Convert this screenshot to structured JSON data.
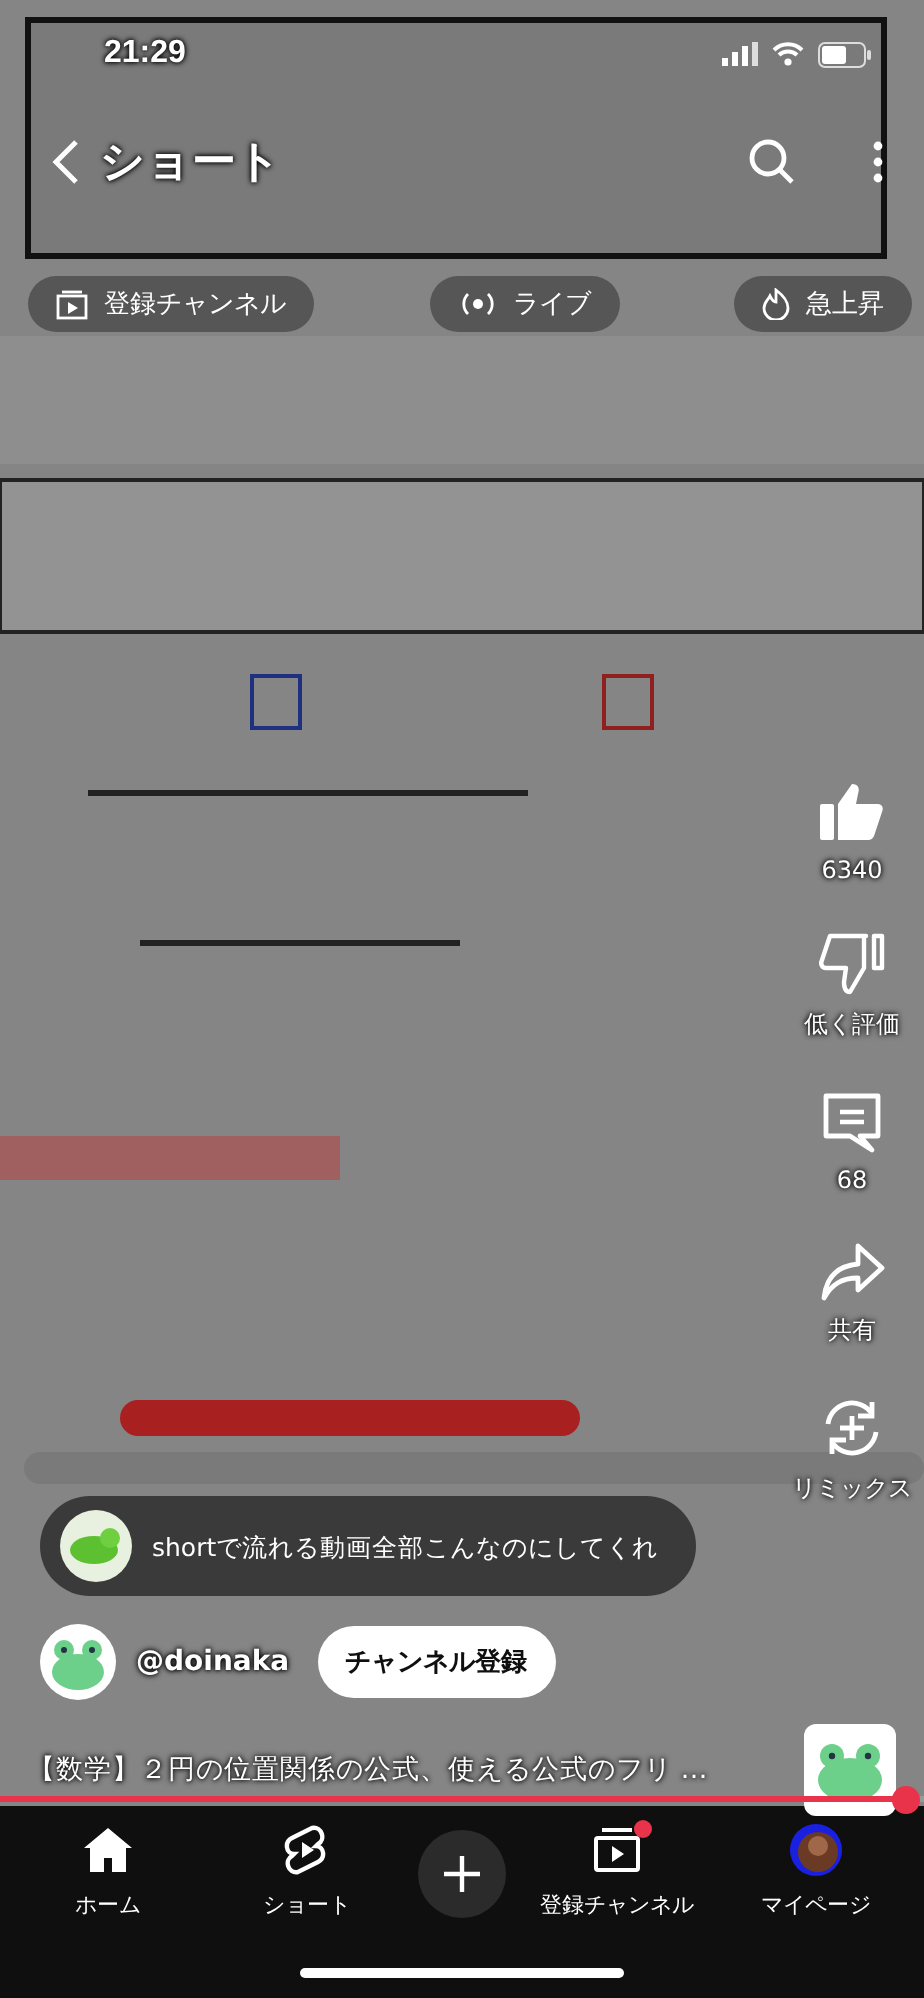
{
  "status_bar": {
    "time": "21:29"
  },
  "header": {
    "title": "ショート"
  },
  "tabs": [
    {
      "label": "登録チャンネル"
    },
    {
      "label": "ライブ"
    },
    {
      "label": "急上昇"
    }
  ],
  "actions": [
    {
      "label": "6340"
    },
    {
      "label": "低く評価"
    },
    {
      "label": "68"
    },
    {
      "label": "共有"
    },
    {
      "label": "リミックス"
    }
  ],
  "top_comment": {
    "text": "shortで流れる動画全部こんなのにしてくれ"
  },
  "channel": {
    "handle": "@doinaka",
    "subscribe": "チャンネル登録"
  },
  "video_title": "【数学】２円の位置関係の公式、使える公式のフリ …",
  "progress": {
    "level": 0.98
  },
  "nav": [
    {
      "kind": "tab",
      "label": "ホーム"
    },
    {
      "kind": "tab",
      "label": "ショート"
    },
    {
      "kind": "create"
    },
    {
      "kind": "tab",
      "label": "登録チャンネル",
      "dot": true
    },
    {
      "kind": "tab",
      "label": "マイページ"
    }
  ]
}
